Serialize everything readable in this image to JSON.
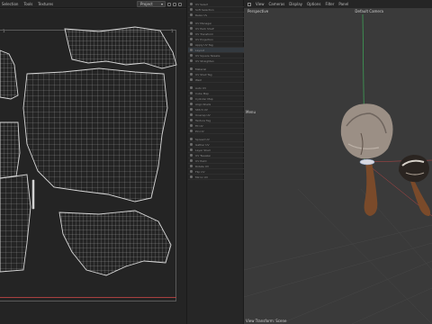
{
  "uv_editor": {
    "menu": [
      "Selection",
      "Tools",
      "Textures"
    ],
    "dropdown": "Project",
    "number_left": "1",
    "number_right": "1"
  },
  "object_manager": {
    "items": [
      "UV Select",
      "Soft Selection",
      "Relax UV",
      "UV Manager",
      "UV Pack Shelf",
      "UV Transform",
      "UV Projection",
      "Apply UV Tag",
      "Layout",
      "UV Square Tweaks",
      "UV Straighten",
      "Material",
      "UV Shell Tag",
      "Weld",
      "Auto UV",
      "Cube Map",
      "Cylinder Map",
      "Align Shells",
      "Stitch UV",
      "Unwrap UV",
      "Texture Tag",
      "Fit UV",
      "Pin UV",
      "Spread UV",
      "Gather UV",
      "Layer Shell",
      "UV Tweaker",
      "UV Paint",
      "Rotate UV",
      "Flip UV",
      "Mirror UV"
    ]
  },
  "viewport": {
    "menu": [
      "View",
      "Cameras",
      "Display",
      "Options",
      "Filter",
      "Panel"
    ],
    "view_label": "Perspective",
    "camera_label": "Default Camera",
    "grid_label": "Menu",
    "status": "View Transform: Scene"
  },
  "colors": {
    "uv_lines": "#c8c8c8",
    "y_axis": "#3fae5a",
    "x_axis": "#b84545",
    "mushroom_cap": "#9b8f85",
    "mushroom_stem": "#7a4a2a"
  }
}
